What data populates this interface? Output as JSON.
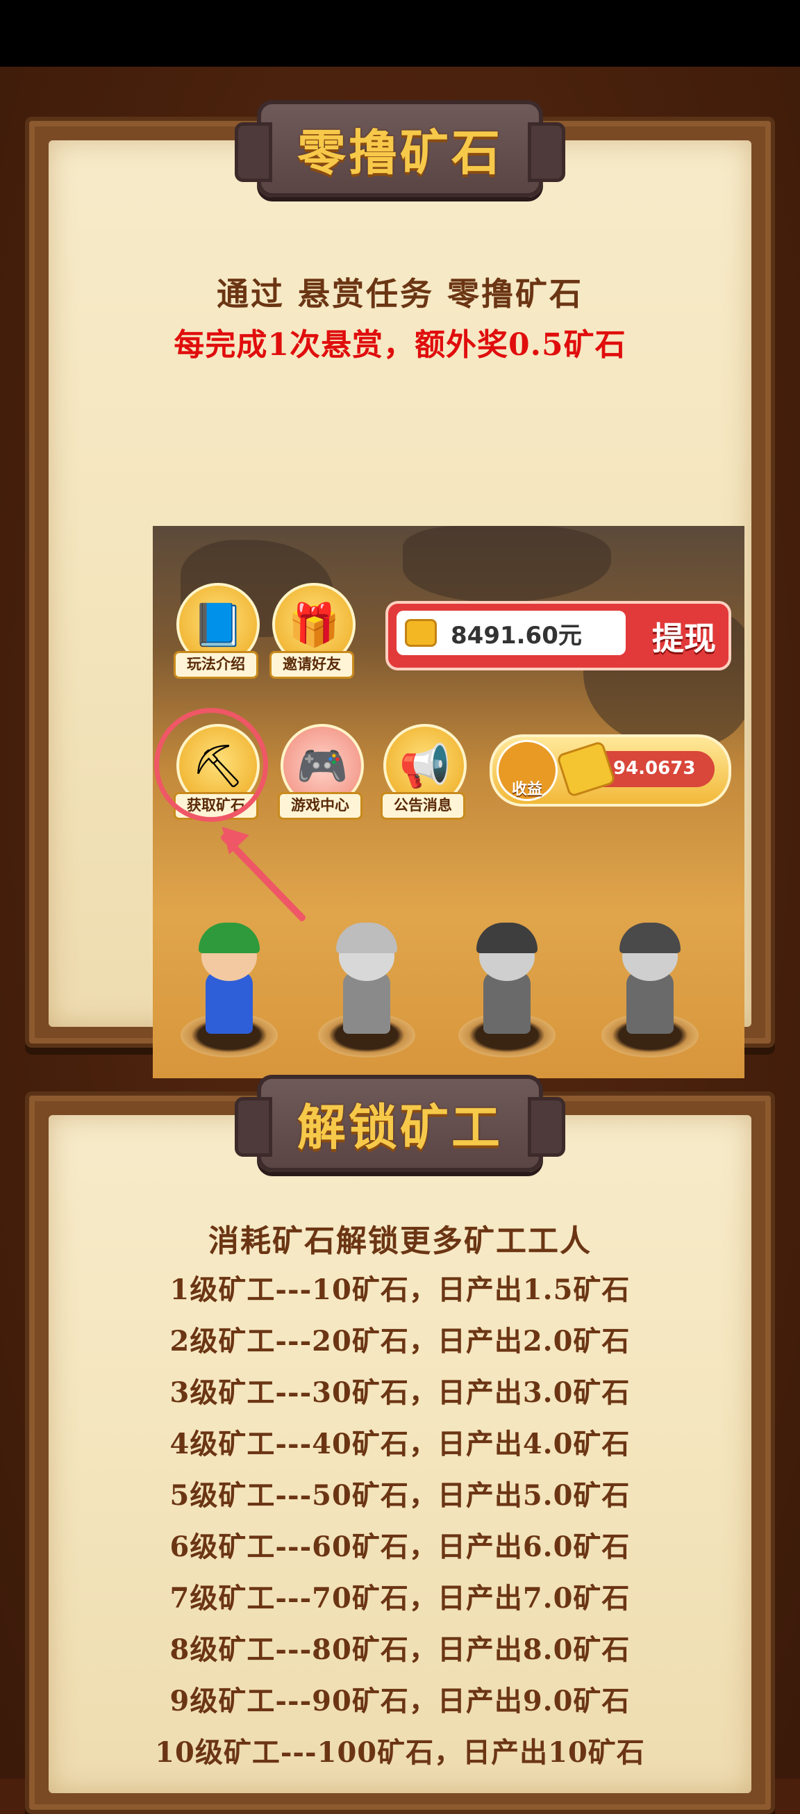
{
  "section1": {
    "title": "零撸矿石",
    "line1": "通过 悬赏任务 零撸矿石",
    "line2": "每完成1次悬赏，额外奖0.5矿石",
    "game": {
      "icons": [
        {
          "label": "玩法介绍"
        },
        {
          "label": "邀请好友"
        },
        {
          "label": "获取矿石"
        },
        {
          "label": "游戏中心"
        },
        {
          "label": "公告消息"
        }
      ],
      "balance": "8491.60元",
      "withdraw": "提现",
      "earnings_label": "收益",
      "earnings_value": "94.0673"
    }
  },
  "section2": {
    "title": "解锁矿工",
    "intro": "消耗矿石解锁更多矿工工人",
    "rows": [
      "1级矿工---10矿石，日产出1.5矿石",
      "2级矿工---20矿石，日产出2.0矿石",
      "3级矿工---30矿石，日产出3.0矿石",
      "4级矿工---40矿石，日产出4.0矿石",
      "5级矿工---50矿石，日产出5.0矿石",
      "6级矿工---60矿石，日产出6.0矿石",
      "7级矿工---70矿石，日产出7.0矿石",
      "8级矿工---80矿石，日产出8.0矿石",
      "9级矿工---90矿石，日产出9.0矿石",
      "10级矿工---100矿石，日产出10矿石"
    ]
  },
  "colors": {
    "background": "#4a1f0c",
    "paper": "#f4e5bd",
    "banner_text": "#f7c94a",
    "text_brown": "#6b3514",
    "text_red": "#e00d0d"
  }
}
